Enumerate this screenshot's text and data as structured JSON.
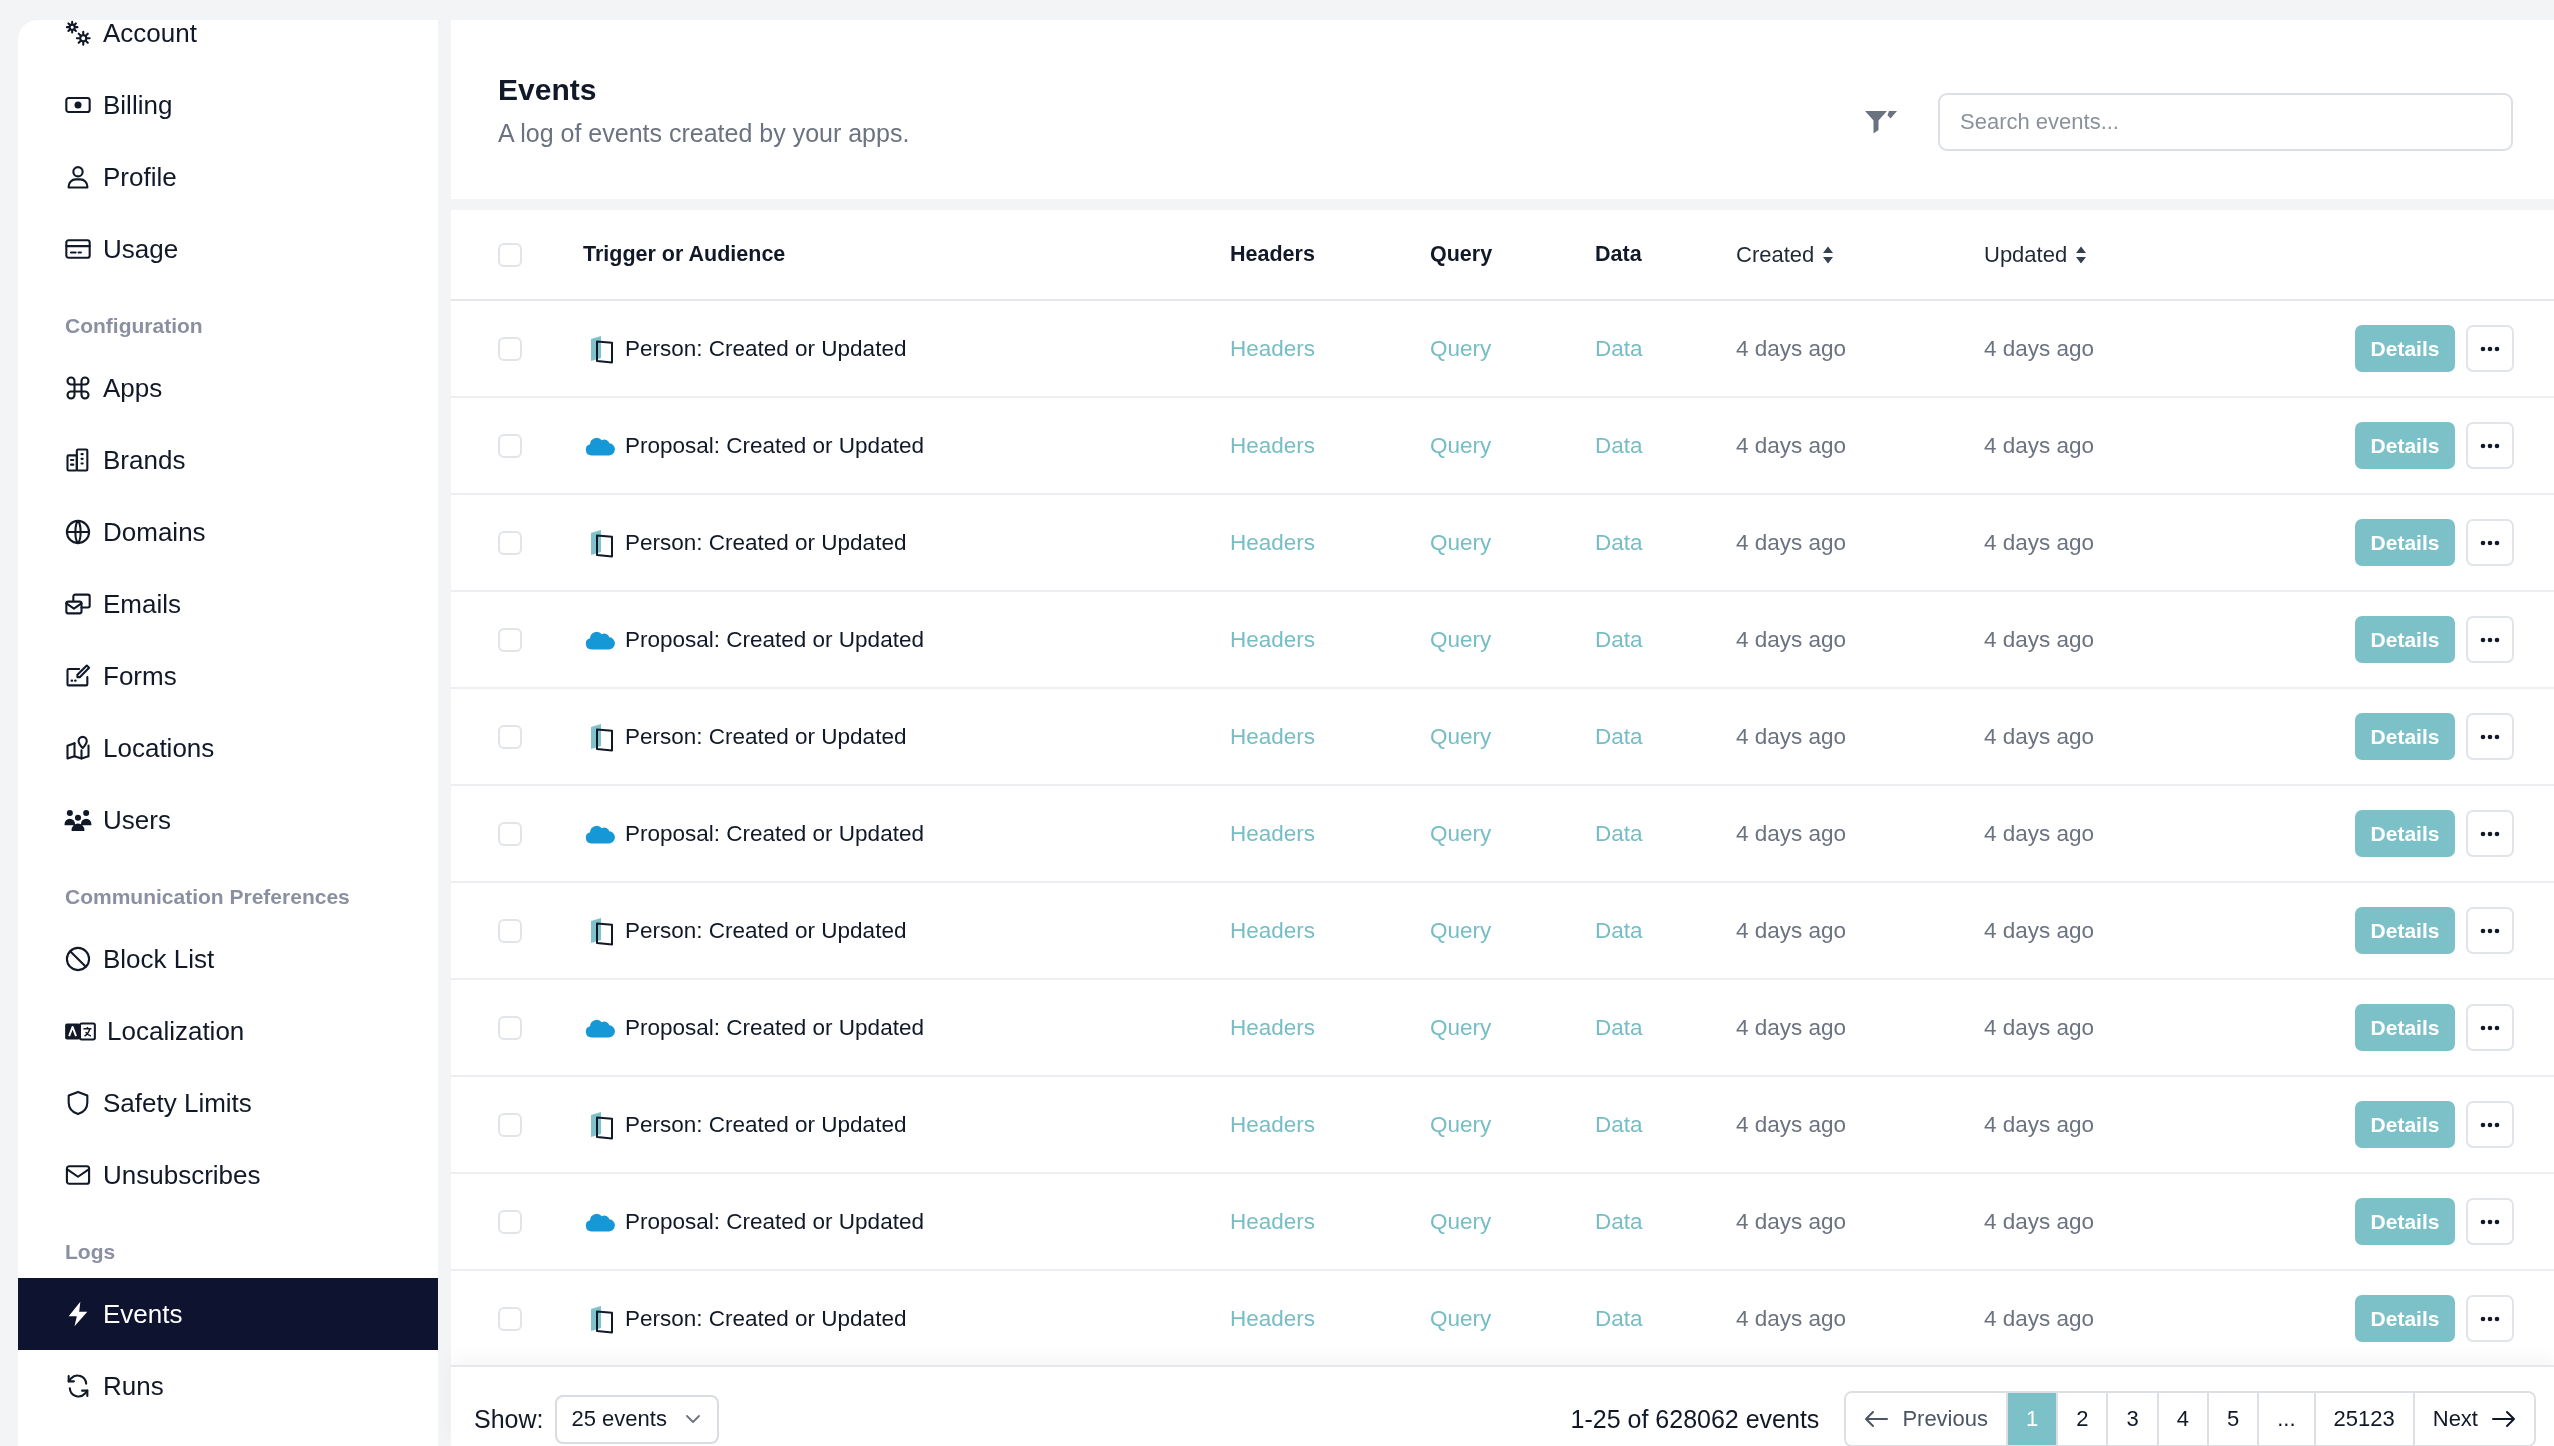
{
  "sidebar": {
    "sections": [
      {
        "items": [
          {
            "label": "Account",
            "selected": false
          },
          {
            "label": "Billing",
            "selected": false
          },
          {
            "label": "Profile",
            "selected": false
          },
          {
            "label": "Usage",
            "selected": false
          }
        ]
      },
      {
        "title": "Configuration",
        "items": [
          {
            "label": "Apps",
            "selected": false
          },
          {
            "label": "Brands",
            "selected": false
          },
          {
            "label": "Domains",
            "selected": false
          },
          {
            "label": "Emails",
            "selected": false
          },
          {
            "label": "Forms",
            "selected": false
          },
          {
            "label": "Locations",
            "selected": false
          },
          {
            "label": "Users",
            "selected": false
          }
        ]
      },
      {
        "title": "Communication Preferences",
        "items": [
          {
            "label": "Block List",
            "selected": false
          },
          {
            "label": "Localization",
            "selected": false
          },
          {
            "label": "Safety Limits",
            "selected": false
          },
          {
            "label": "Unsubscribes",
            "selected": false
          }
        ]
      },
      {
        "title": "Logs",
        "items": [
          {
            "label": "Events",
            "selected": true
          },
          {
            "label": "Runs",
            "selected": false
          }
        ]
      }
    ]
  },
  "header": {
    "title": "Events",
    "subtitle": "A log of events created by your apps.",
    "search": {
      "placeholder": "Search events..."
    }
  },
  "table": {
    "header_checkbox": {
      "checked": false
    },
    "columns": [
      {
        "label": "Trigger or Audience",
        "sortable": false
      },
      {
        "label": "Headers",
        "sortable": false
      },
      {
        "label": "Query",
        "sortable": false
      },
      {
        "label": "Data",
        "sortable": false
      },
      {
        "label": "Created",
        "sortable": true
      },
      {
        "label": "Updated",
        "sortable": true
      }
    ],
    "rows": [
      {
        "kind": "document",
        "checked": false,
        "trigger": "Person: Created or Updated",
        "headers": "Headers",
        "query": "Query",
        "data": "Data",
        "created": "4 days ago",
        "updated": "4 days ago",
        "action": "Details"
      },
      {
        "kind": "cloud",
        "checked": false,
        "trigger": "Proposal: Created or Updated",
        "headers": "Headers",
        "query": "Query",
        "data": "Data",
        "created": "4 days ago",
        "updated": "4 days ago",
        "action": "Details"
      },
      {
        "kind": "document",
        "checked": false,
        "trigger": "Person: Created or Updated",
        "headers": "Headers",
        "query": "Query",
        "data": "Data",
        "created": "4 days ago",
        "updated": "4 days ago",
        "action": "Details"
      },
      {
        "kind": "cloud",
        "checked": false,
        "trigger": "Proposal: Created or Updated",
        "headers": "Headers",
        "query": "Query",
        "data": "Data",
        "created": "4 days ago",
        "updated": "4 days ago",
        "action": "Details"
      },
      {
        "kind": "document",
        "checked": false,
        "trigger": "Person: Created or Updated",
        "headers": "Headers",
        "query": "Query",
        "data": "Data",
        "created": "4 days ago",
        "updated": "4 days ago",
        "action": "Details"
      },
      {
        "kind": "cloud",
        "checked": false,
        "trigger": "Proposal: Created or Updated",
        "headers": "Headers",
        "query": "Query",
        "data": "Data",
        "created": "4 days ago",
        "updated": "4 days ago",
        "action": "Details"
      },
      {
        "kind": "document",
        "checked": false,
        "trigger": "Person: Created or Updated",
        "headers": "Headers",
        "query": "Query",
        "data": "Data",
        "created": "4 days ago",
        "updated": "4 days ago",
        "action": "Details"
      },
      {
        "kind": "cloud",
        "checked": false,
        "trigger": "Proposal: Created or Updated",
        "headers": "Headers",
        "query": "Query",
        "data": "Data",
        "created": "4 days ago",
        "updated": "4 days ago",
        "action": "Details"
      },
      {
        "kind": "document",
        "checked": false,
        "trigger": "Person: Created or Updated",
        "headers": "Headers",
        "query": "Query",
        "data": "Data",
        "created": "4 days ago",
        "updated": "4 days ago",
        "action": "Details"
      },
      {
        "kind": "cloud",
        "checked": false,
        "trigger": "Proposal: Created or Updated",
        "headers": "Headers",
        "query": "Query",
        "data": "Data",
        "created": "4 days ago",
        "updated": "4 days ago",
        "action": "Details"
      },
      {
        "kind": "document",
        "checked": false,
        "trigger": "Person: Created or Updated",
        "headers": "Headers",
        "query": "Query",
        "data": "Data",
        "created": "4 days ago",
        "updated": "4 days ago",
        "action": "Details"
      }
    ]
  },
  "footer": {
    "show_label": "Show:",
    "page_size": "25 events",
    "summary": "1-25 of 628062 events",
    "pagination": {
      "previous": "Previous",
      "pages": [
        {
          "label": "1",
          "selected": true
        },
        {
          "label": "2",
          "selected": false
        },
        {
          "label": "3",
          "selected": false
        },
        {
          "label": "4",
          "selected": false
        },
        {
          "label": "5",
          "selected": false
        },
        {
          "label": "...",
          "selected": false
        },
        {
          "label": "25123",
          "selected": false
        }
      ],
      "next": "Next"
    }
  }
}
